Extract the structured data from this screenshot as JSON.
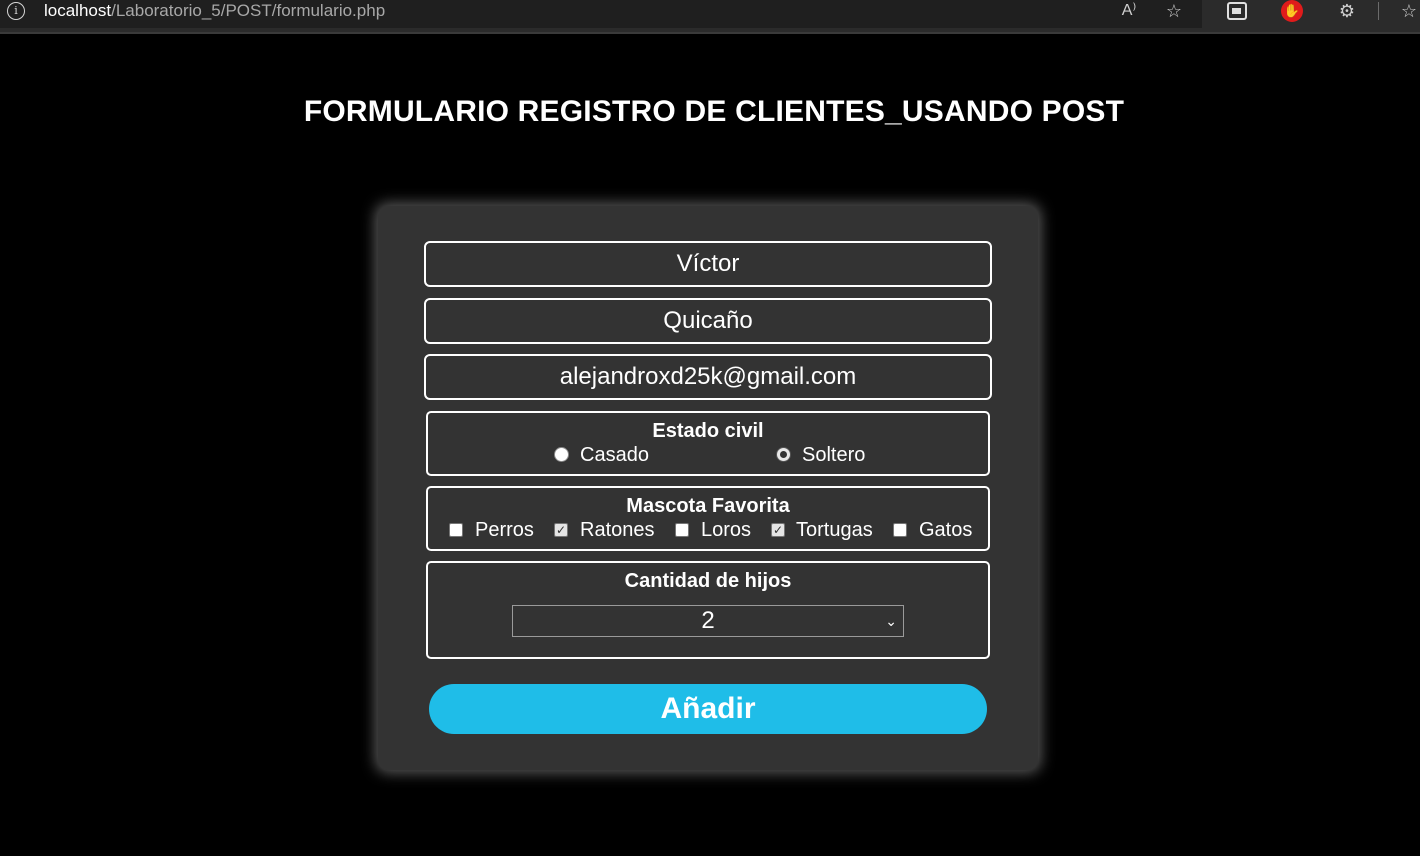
{
  "browser": {
    "url_host": "localhost",
    "url_path": "/Laboratorio_5/POST/formulario.php",
    "icons": [
      "info-icon",
      "read-aloud-icon",
      "add-favorite-icon",
      "split-screen-icon",
      "adblock-icon",
      "extensions-icon",
      "favorites-icon"
    ]
  },
  "page": {
    "title": "FORMULARIO REGISTRO DE CLIENTES_USANDO POST"
  },
  "form": {
    "nombre": "Víctor",
    "apellido": "Quicaño",
    "email": "alejandroxd25k@gmail.com",
    "estado_civil": {
      "legend": "Estado civil",
      "options": [
        {
          "label": "Casado",
          "checked": false
        },
        {
          "label": "Soltero",
          "checked": true
        }
      ]
    },
    "mascota": {
      "legend": "Mascota Favorita",
      "options": [
        {
          "label": "Perros",
          "checked": false
        },
        {
          "label": "Ratones",
          "checked": true
        },
        {
          "label": "Loros",
          "checked": false
        },
        {
          "label": "Tortugas",
          "checked": true
        },
        {
          "label": "Gatos",
          "checked": false
        }
      ]
    },
    "hijos": {
      "legend": "Cantidad de hijos",
      "selected": "2"
    },
    "submit_label": "Añadir",
    "colors": {
      "button": "#1fbde8",
      "card": "#333333",
      "background": "#000000"
    }
  }
}
